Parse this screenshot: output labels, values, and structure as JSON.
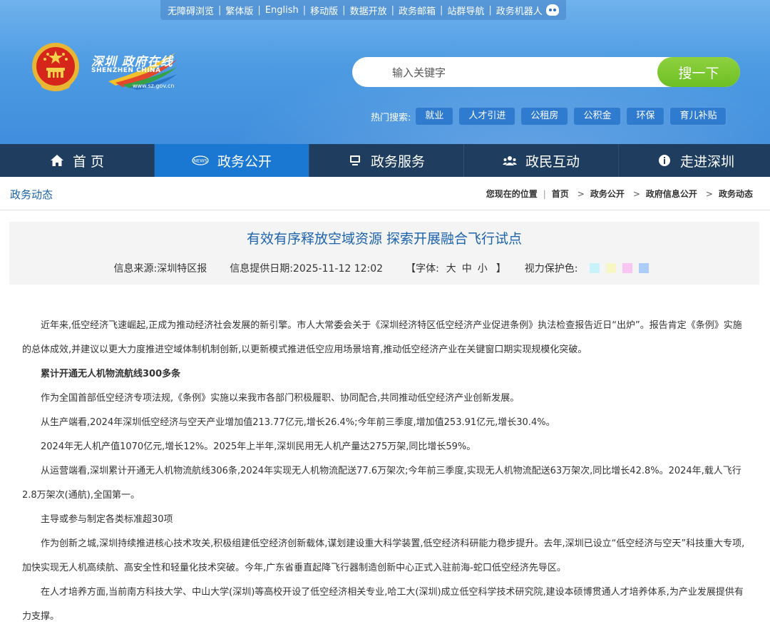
{
  "header": {
    "top_links": [
      "无障碍浏览",
      "繁体版",
      "English",
      "移动版",
      "数据开放",
      "政务邮箱",
      "站群导航",
      "政务机器人"
    ],
    "logo": {
      "cn": "深圳 政府在线",
      "en": "SHENZHEN CHINA",
      "url": "www.sz.gov.cn"
    },
    "search": {
      "placeholder": "输入关键字",
      "button": "搜一下"
    },
    "hot_label": "热门搜索:",
    "hot_tags": [
      "就业",
      "人才引进",
      "公租房",
      "公积金",
      "环保",
      "育儿补贴"
    ]
  },
  "nav": [
    {
      "label": "首 页",
      "icon": "home-icon"
    },
    {
      "label": "政务公开",
      "icon": "news-icon"
    },
    {
      "label": "政务服务",
      "icon": "monitor-icon"
    },
    {
      "label": "政民互动",
      "icon": "people-icon"
    },
    {
      "label": "走进深圳",
      "icon": "info-bubble-icon"
    }
  ],
  "page": {
    "section_title": "政务动态",
    "breadcrumb": [
      "您现在的位置",
      "首页",
      "政务公开",
      "政府信息公开",
      "政务动态"
    ]
  },
  "article": {
    "title": "有效有序释放空域资源 探索开展融合飞行试点",
    "source": "信息来源:深圳特区报",
    "date": "信息提供日期:2025-11-12 12:02",
    "font_label": "【字体:",
    "font_sizes": [
      "大",
      "中",
      "小"
    ],
    "font_close": "】",
    "eye_label": "视力保护色:",
    "eye_colors": [
      "#c9f1f9",
      "#f7f7c6",
      "#f9c5f2",
      "#a9cdf6"
    ],
    "paragraphs": [
      {
        "text": "近年来,低空经济飞速崛起,正成为推动经济社会发展的新引擎。市人大常委会关于《深圳经济特区低空经济产业促进条例》执法检查报告近日“出炉”。报告肯定《条例》实施的总体成效,并建议以更大力度推进空域体制机制创新,以更新模式推进低空应用场景培育,推动低空经济产业在关键窗口期实现规模化突破。",
        "bold": false
      },
      {
        "text": "累计开通无人机物流航线300多条",
        "bold": true
      },
      {
        "text": "作为全国首部低空经济专项法规,《条例》实施以来我市各部门积极履职、协同配合,共同推动低空经济产业创新发展。",
        "bold": false
      },
      {
        "text": "从生产端看,2024年深圳低空经济与空天产业增加值213.77亿元,增长26.4%;今年前三季度,增加值253.91亿元,增长30.4%。",
        "bold": false
      },
      {
        "text": "2024年无人机产值1070亿元,增长12%。2025年上半年,深圳民用无人机产量达275万架,同比增长59%。",
        "bold": false
      },
      {
        "text": "从运营端看,深圳累计开通无人机物流航线306条,2024年实现无人机物流配送77.6万架次;今年前三季度,实现无人机物流配送63万架次,同比增长42.8%。2024年,载人飞行2.8万架次(通航),全国第一。",
        "bold": false
      },
      {
        "text": "主导或参与制定各类标准超30项",
        "bold": false
      },
      {
        "text": "作为创新之城,深圳持续推进核心技术攻关,积极组建低空经济创新载体,谋划建设重大科学装置,低空经济科研能力稳步提升。去年,深圳已设立“低空经济与空天”科技重大专项,加快实现无人机高续航、高安全性和轻量化技术突破。今年,广东省垂直起降飞行器制造创新中心正式入驻前海-蛇口低空经济先导区。",
        "bold": false
      },
      {
        "text": "在人才培养方面,当前南方科技大学、中山大学(深圳)等高校开设了低空经济相关专业,哈工大(深圳)成立低空科学技术研究院,建设本硕博贯通人才培养体系,为产业发展提供有力支撑。",
        "bold": false
      }
    ]
  },
  "colors": {
    "nav_bg": "#1e3d5f",
    "nav_active": "#1a78d2",
    "accent_blue": "#1c63ad",
    "search_green": "#7cc832"
  }
}
